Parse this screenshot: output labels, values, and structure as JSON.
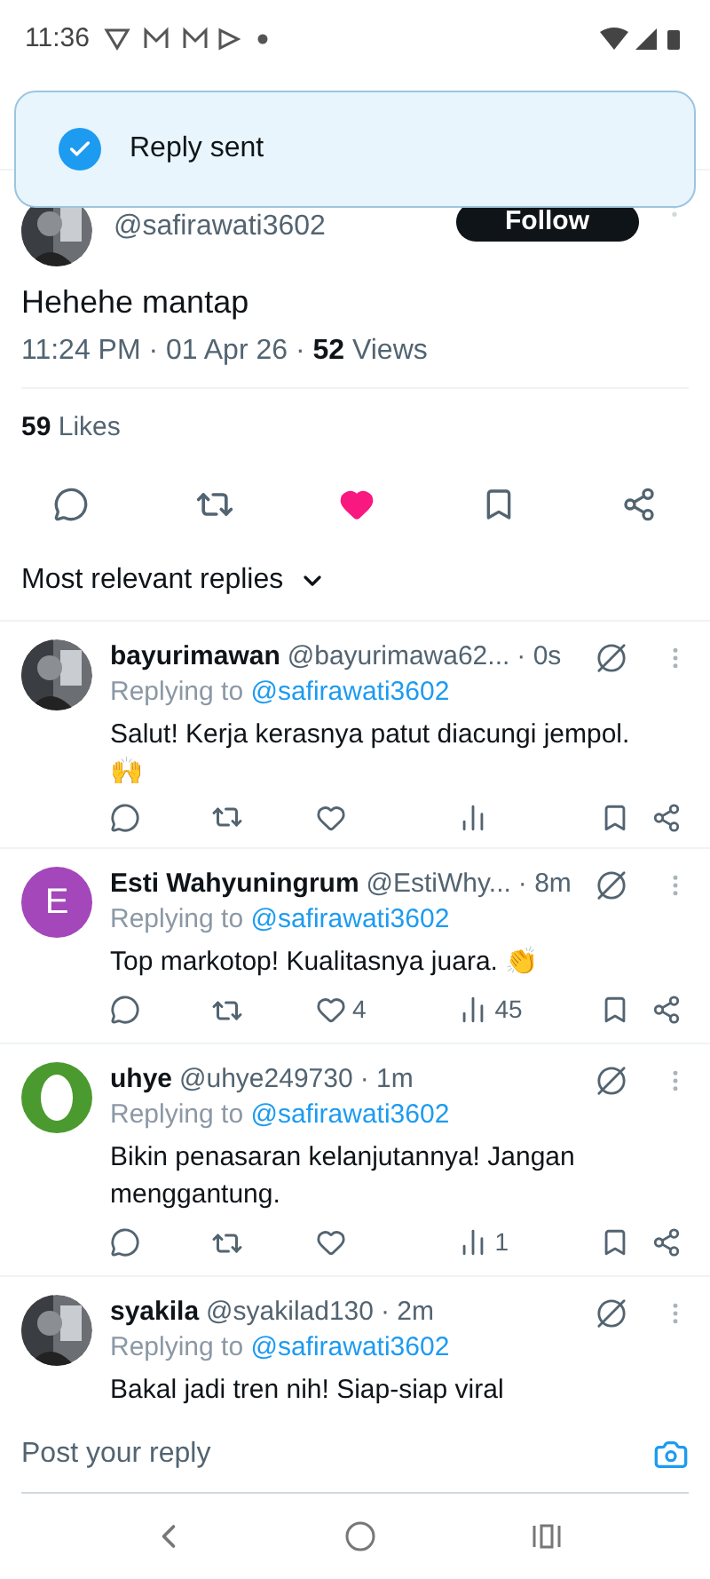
{
  "status_bar": {
    "time": "11:36"
  },
  "toast": {
    "text": "Reply sent"
  },
  "post": {
    "handle": "@safirawati3602",
    "follow_label": "Follow",
    "text": "Hehehe mantap",
    "meta": "11:24 PM · 01 Apr 26 · ",
    "views_count": "52",
    "views_label": " Views",
    "likes_count": "59",
    "likes_label": " Likes",
    "liked": true,
    "bookmarked": false
  },
  "sort": {
    "label": "Most relevant replies"
  },
  "replies": [
    {
      "name": "bayurimawan",
      "handle": "@bayurimawa62...",
      "time": "· 0s",
      "replying_label": "Replying to",
      "replying_to": "@safirawati3602",
      "text": "Salut! Kerja kerasnya patut diacungi jempol. 🙌"
    },
    {
      "avatar": {
        "kind": "letter",
        "letter": "E",
        "color": "#a347ba"
      },
      "name": "Esti Wahyuningrum",
      "handle": "@EstiWhy...",
      "time": "· 8m",
      "replying_label": "Replying to",
      "replying_to": "@safirawati3602",
      "text": "Top markotop! Kualitasnya juara. 👏",
      "likes": "4",
      "views": "45"
    },
    {
      "avatar": {
        "kind": "ring",
        "color": "#4b9a2f"
      },
      "name": "uhye",
      "handle": "@uhye249730",
      "time": "· 1m",
      "replying_label": "Replying to",
      "replying_to": "@safirawati3602",
      "text": "Bikin penasaran kelanjutannya! Jangan menggantung.",
      "views": "1"
    },
    {
      "name": "syakila",
      "handle": "@syakilad130",
      "time": "· 2m",
      "replying_label": "Replying to",
      "replying_to": "@safirawati3602",
      "text": "Bakal jadi tren nih! Siap-siap viral"
    }
  ],
  "reply_bar": {
    "placeholder": "Post your reply"
  }
}
